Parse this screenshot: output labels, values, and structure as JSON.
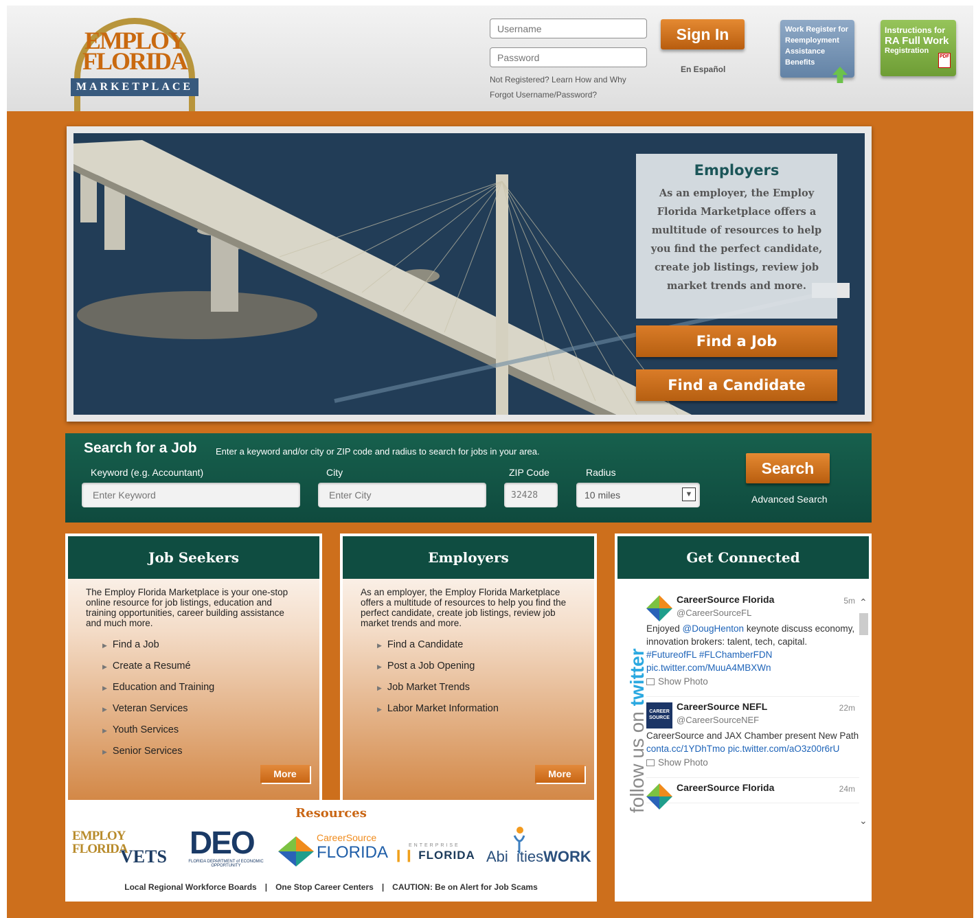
{
  "header": {
    "logo": {
      "line1": "EMPLOY",
      "line2": "FLORIDA",
      "line3": "MARKETPLACE"
    },
    "username_placeholder": "Username",
    "password_placeholder": "Password",
    "not_registered": "Not Registered? Learn How and Why",
    "forgot": "Forgot Username/Password?",
    "signin": "Sign In",
    "espanol": "En Español",
    "work_register": "Work Register for Reemployment Assistance Benefits",
    "ra_line1": "Instructions for",
    "ra_line2": "RA Full Work",
    "ra_line3": "Registration",
    "pdf_label": "PDF"
  },
  "hero": {
    "panel_title": "Employers",
    "panel_text": "As an employer, the Employ Florida Marketplace offers a multitude of resources to help you find the perfect candidate, create job listings, review job market trends and more.",
    "find_job": "Find a Job",
    "find_candidate": "Find a Candidate"
  },
  "search": {
    "title": "Search for a Job",
    "desc": "Enter a keyword and/or city or ZIP code and radius to search for jobs in your area.",
    "keyword_label": "Keyword (e.g. Accountant)",
    "keyword_placeholder": "Enter Keyword",
    "city_label": "City",
    "city_placeholder": "Enter City",
    "zip_label": "ZIP Code",
    "zip_value": "32428",
    "radius_label": "Radius",
    "radius_value": "10 miles",
    "search_button": "Search",
    "advanced": "Advanced Search"
  },
  "job_seekers": {
    "title": "Job Seekers",
    "desc": "The Employ Florida Marketplace is your one-stop online resource for job listings, education and training opportunities, career building assistance and much more.",
    "items": [
      "Find a Job",
      "Create a Resumé",
      "Education and Training",
      "Veteran Services",
      "Youth Services",
      "Senior Services"
    ],
    "more": "More"
  },
  "employers": {
    "title": "Employers",
    "desc": "As an employer, the Employ Florida Marketplace offers a multitude of resources to help you find the perfect candidate, create job listings, review job market trends and more.",
    "items": [
      "Find a Candidate",
      "Post a Job Opening",
      "Job Market Trends",
      "Labor Market Information"
    ],
    "more": "More"
  },
  "resources": {
    "title": "Resources",
    "logos": {
      "vets_a": "EMPLOY FLORIDA",
      "vets_b": "VETS",
      "deo_a": "DEO",
      "deo_b": "FLORIDA DEPARTMENT of ECONOMIC OPPORTUNITY",
      "csf_a": "CareerSource",
      "csf_b": "FLORIDA",
      "ef_a": "ENTERPRISE",
      "ef_b": "FLORIDA",
      "abil_pre": "Abi",
      "abil_mid": "ities",
      "abil_post": "WORK"
    },
    "links": [
      "Local Regional Workforce Boards",
      "One Stop Career Centers",
      "CAUTION: Be on Alert for Job Scams"
    ]
  },
  "connect": {
    "title": "Get Connected",
    "side_text": "follow us on",
    "side_brand": "twitter",
    "tweets": [
      {
        "name": "CareerSource Florida",
        "handle": "@CareerSourceFL",
        "time": "5m",
        "text_pre": "Enjoyed ",
        "mention": "@DougHenton",
        "text_mid": " keynote discuss economy, innovation brokers: talent, tech, capital. ",
        "tag1": "#FutureofFL",
        "tag2": "#FLChamberFDN",
        "link": "pic.twitter.com/MuuA4MBXWn",
        "photo": "Show Photo"
      },
      {
        "name": "CareerSource NEFL",
        "handle": "@CareerSourceNEF",
        "time": "22m",
        "avatar_text": "CAREER SOURCE",
        "text_pre": "CareerSource and JAX Chamber present New Path ",
        "link1": "conta.cc/1YDhTmo",
        "link2": "pic.twitter.com/aO3z00r6rU",
        "photo": "Show Photo"
      },
      {
        "name": "CareerSource Florida",
        "time": "24m"
      }
    ]
  },
  "colors": {
    "orange": "#cd6f1c",
    "teal": "#0f4d41",
    "link_blue": "#1d63b8",
    "twitter_blue": "#2aa8e0"
  }
}
